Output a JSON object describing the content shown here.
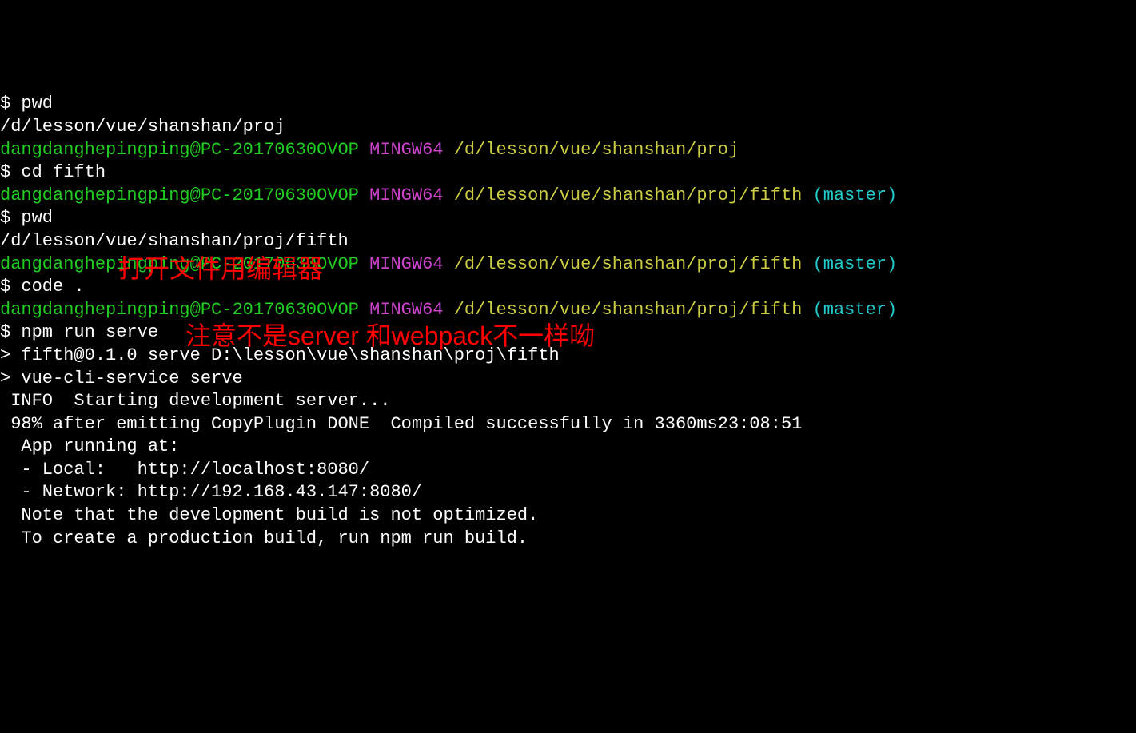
{
  "lines": {
    "l1_prompt": "$ pwd",
    "l2_output": "/d/lesson/vue/shanshan/proj",
    "l3_blank": "",
    "l4_user": "dangdanghepingping@PC-20170630OVOP",
    "l4_mingw": " MINGW64",
    "l4_path": " /d/lesson/vue/shanshan/proj",
    "l5_prompt": "$ cd fifth",
    "l6_blank": "",
    "l7_user": "dangdanghepingping@PC-20170630OVOP",
    "l7_mingw": " MINGW64",
    "l7_path": " /d/lesson/vue/shanshan/proj/fifth",
    "l7_branch": " (master)",
    "l8_prompt": "$ pwd",
    "l9_output": "/d/lesson/vue/shanshan/proj/fifth",
    "l10_blank": "",
    "l11_user": "dangdanghepingping@PC-20170630OVOP",
    "l11_mingw": " MINGW64",
    "l11_path": " /d/lesson/vue/shanshan/proj/fifth",
    "l11_branch": " (master)",
    "l12_prompt": "$ code .",
    "l13_blank": "",
    "l14_user": "dangdanghepingping@PC-20170630OVOP",
    "l14_mingw": " MINGW64",
    "l14_path": " /d/lesson/vue/shanshan/proj/fifth",
    "l14_branch": " (master)",
    "l15_prompt": "$ npm run serve",
    "l16_blank": "",
    "l17_output": "> fifth@0.1.0 serve D:\\lesson\\vue\\shanshan\\proj\\fifth",
    "l18_output": "> vue-cli-service serve",
    "l19_blank": "",
    "l20_output": " INFO  Starting development server...",
    "l21_output": " 98% after emitting CopyPlugin DONE  Compiled successfully in 3360ms23:08:51",
    "l22_blank": "",
    "l23_blank": "",
    "l24_output": "  App running at:",
    "l25_output": "  - Local:   http://localhost:8080/",
    "l26_output": "  - Network: http://192.168.43.147:8080/",
    "l27_blank": "",
    "l28_output": "  Note that the development build is not optimized.",
    "l29_output": "  To create a production build, run npm run build."
  },
  "annotations": {
    "note1": "打开文件用编辑器",
    "note2": "注意不是server 和webpack不一样呦"
  }
}
